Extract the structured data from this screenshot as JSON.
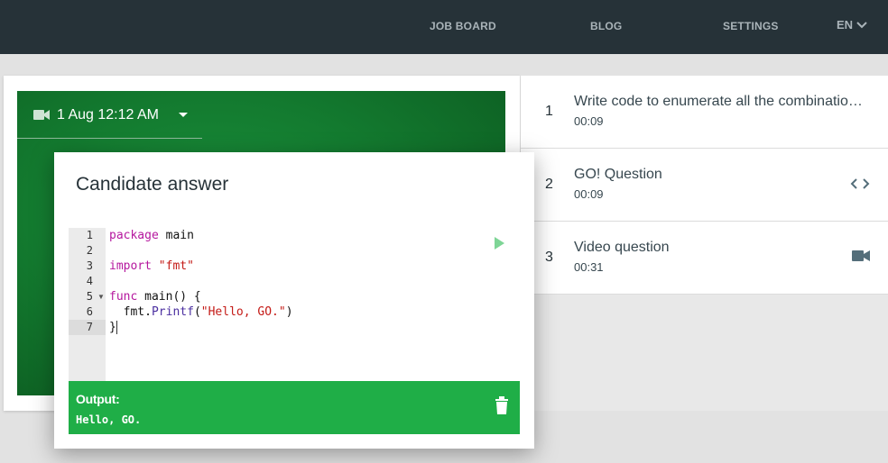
{
  "nav": {
    "items": [
      "JOB BOARD",
      "BLOG",
      "SETTINGS"
    ],
    "lang": "EN"
  },
  "video": {
    "date": "1 Aug 12:12 AM",
    "icon": "video-camera-icon"
  },
  "questions": [
    {
      "num": "1",
      "title": "Write code to enumerate all the combinatio…",
      "time": "00:09",
      "icon": ""
    },
    {
      "num": "2",
      "title": "GO! Question",
      "time": "00:09",
      "icon": "code-icon"
    },
    {
      "num": "3",
      "title": "Video question",
      "time": "00:31",
      "icon": "video-camera-icon"
    }
  ],
  "modal": {
    "title": "Candidate answer",
    "line_numbers": [
      "1",
      "2",
      "3",
      "4",
      "5",
      "6",
      "7"
    ],
    "code": {
      "l1_kw": "package",
      "l1_rest": " main",
      "l3_kw": "import",
      "l3_str": " \"fmt\"",
      "l5_kw": "func",
      "l5_rest": " main() {",
      "l6_pre": "  fmt.",
      "l6_fn": "Printf",
      "l6_open": "(",
      "l6_str": "\"Hello, GO.\"",
      "l6_close": ")",
      "l7": "}"
    },
    "output_label": "Output:",
    "output_text": "Hello, GO."
  },
  "colors": {
    "nav_bg": "#263238",
    "output_bg": "#1fae47",
    "video_bg": "#137a2f"
  }
}
